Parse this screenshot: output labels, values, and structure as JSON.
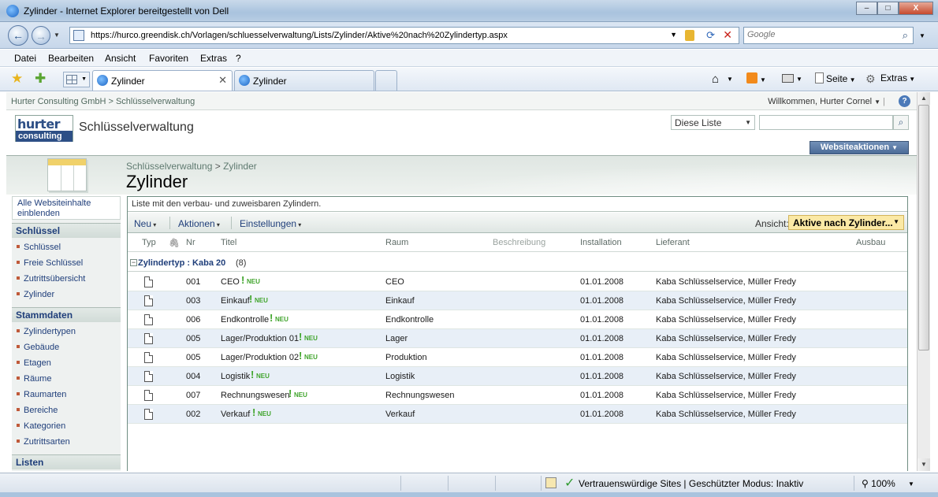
{
  "window": {
    "title": "Zylinder - Internet Explorer bereitgestellt von Dell",
    "buttons": {
      "minimize": "–",
      "maximize": "□",
      "close": "X"
    }
  },
  "addressbar": {
    "url": "https://hurco.greendisk.ch/Vorlagen/schluesselverwaltung/Lists/Zylinder/Aktive%20nach%20Zylindertyp.aspx",
    "search_placeholder": "Google"
  },
  "menu": [
    "Datei",
    "Bearbeiten",
    "Ansicht",
    "Favoriten",
    "Extras",
    "?"
  ],
  "tabs": [
    {
      "label": "Zylinder",
      "active": true
    },
    {
      "label": "Zylinder",
      "active": false
    }
  ],
  "commandbar": {
    "page": "Seite",
    "tools": "Extras"
  },
  "sharepoint": {
    "global_crumb": "Hurter Consulting GmbH > Schlüsselverwaltung",
    "welcome": "Willkommen, Hurter Cornel",
    "help": "?",
    "logo_top": "hurter",
    "logo_bottom": "consulting",
    "site_title": "Schlüsselverwaltung",
    "search_scope": "Diese Liste",
    "site_actions": "Websiteaktionen",
    "breadcrumb": {
      "parent": "Schlüsselverwaltung",
      "sep": ">",
      "current": "Zylinder"
    },
    "page_title": "Zylinder"
  },
  "leftnav": {
    "all_content": "Alle Websiteinhalte einblenden",
    "sections": [
      {
        "title": "Schlüssel",
        "items": [
          "Schlüssel",
          "Freie Schlüssel",
          "Zutrittsübersicht",
          "Zylinder"
        ]
      },
      {
        "title": "Stammdaten",
        "items": [
          "Zylindertypen",
          "Gebäude",
          "Etagen",
          "Räume",
          "Raumarten",
          "Bereiche",
          "Kategorien",
          "Zutrittsarten"
        ]
      },
      {
        "title": "Listen",
        "items": []
      }
    ]
  },
  "list": {
    "description": "Liste mit den verbau- und zuweisbaren Zylindern.",
    "toolbar": {
      "new": "Neu",
      "actions": "Aktionen",
      "settings": "Einstellungen",
      "view_label": "Ansicht:",
      "view_value": "Aktive nach Zylinder..."
    },
    "columns": [
      "Typ",
      "Nr",
      "Titel",
      "Raum",
      "Beschreibung",
      "Installation",
      "Lieferant",
      "Ausbau"
    ],
    "group": {
      "label": "Zylindertyp : Kaba 20",
      "count": "(8)",
      "toggle": "−"
    },
    "new_label": "NEU",
    "rows": [
      {
        "nr": "001",
        "titel": "CEO",
        "raum": "CEO",
        "installation": "01.01.2008",
        "lieferant": "Kaba Schlüsselservice, Müller Fredy"
      },
      {
        "nr": "003",
        "titel": "Einkauf",
        "raum": "Einkauf",
        "installation": "01.01.2008",
        "lieferant": "Kaba Schlüsselservice, Müller Fredy"
      },
      {
        "nr": "006",
        "titel": "Endkontrolle",
        "raum": "Endkontrolle",
        "installation": "01.01.2008",
        "lieferant": "Kaba Schlüsselservice, Müller Fredy"
      },
      {
        "nr": "005",
        "titel": "Lager/Produktion 01",
        "raum": "Lager",
        "installation": "01.01.2008",
        "lieferant": "Kaba Schlüsselservice, Müller Fredy"
      },
      {
        "nr": "005",
        "titel": "Lager/Produktion 02",
        "raum": "Produktion",
        "installation": "01.01.2008",
        "lieferant": "Kaba Schlüsselservice, Müller Fredy"
      },
      {
        "nr": "004",
        "titel": "Logistik",
        "raum": "Logistik",
        "installation": "01.01.2008",
        "lieferant": "Kaba Schlüsselservice, Müller Fredy"
      },
      {
        "nr": "007",
        "titel": "Rechnungswesen",
        "raum": "Rechnungswesen",
        "installation": "01.01.2008",
        "lieferant": "Kaba Schlüsselservice, Müller Fredy"
      },
      {
        "nr": "002",
        "titel": "Verkauf",
        "raum": "Verkauf",
        "installation": "01.01.2008",
        "lieferant": "Kaba Schlüsselservice, Müller Fredy"
      }
    ]
  },
  "statusbar": {
    "zone": "Vertrauenswürdige Sites | Geschützter Modus: Inaktiv",
    "zoom": "100%"
  },
  "colors": {
    "accent": "#1f3e7a",
    "new_marker": "#3fa42b",
    "alt_row": "#e8eff7",
    "view_select": "#fbe9a5"
  }
}
